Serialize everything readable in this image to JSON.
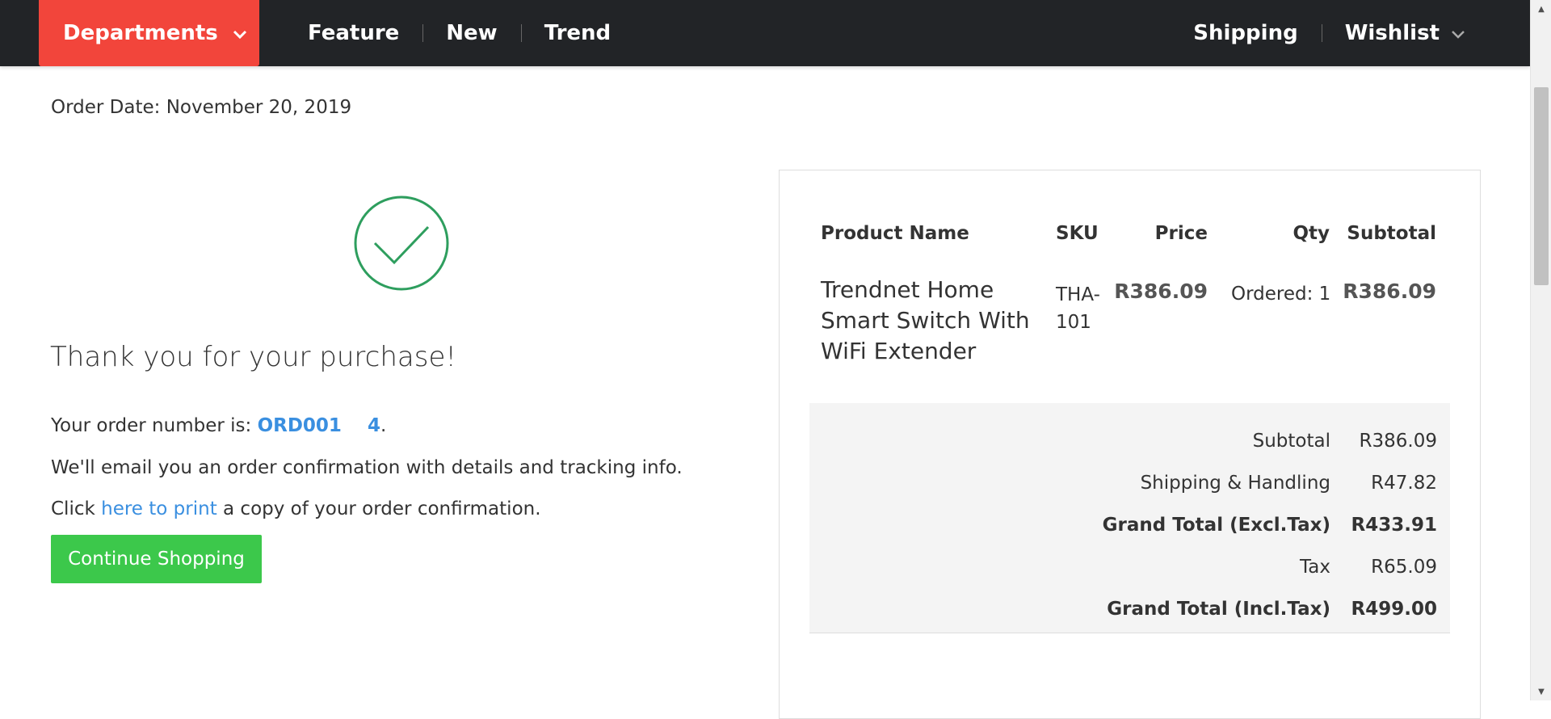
{
  "nav": {
    "departments_label": "Departments",
    "left_items": [
      "Feature",
      "New",
      "Trend"
    ],
    "right_items": [
      "Shipping",
      "Wishlist"
    ]
  },
  "order": {
    "date_text": "Order Date: November 20, 2019",
    "thank_you": "Thank you for your purchase!",
    "order_number_prefix": "Your order number is: ",
    "order_number": "ORD001    4",
    "order_number_suffix": ".",
    "email_text": "We'll email you an order confirmation with details and tracking info.",
    "print_prefix": "Click ",
    "print_link": "here to print",
    "print_suffix": " a copy of your order confirmation.",
    "continue_label": "Continue Shopping"
  },
  "table": {
    "headers": {
      "product": "Product Name",
      "sku": "SKU",
      "price": "Price",
      "qty": "Qty",
      "subtotal": "Subtotal"
    },
    "row": {
      "product": "Trendnet Home Smart Switch With WiFi Extender",
      "sku": "THA-101",
      "price": "R386.09",
      "qty": "Ordered: 1",
      "subtotal": "R386.09"
    }
  },
  "totals": [
    {
      "label": "Subtotal",
      "value": "R386.09"
    },
    {
      "label": "Shipping & Handling",
      "value": "R47.82"
    },
    {
      "label": "Grand Total (Excl.Tax)",
      "value": "R433.91"
    },
    {
      "label": "Tax",
      "value": "R65.09"
    },
    {
      "label": "Grand Total (Incl.Tax)",
      "value": "R499.00"
    }
  ],
  "colors": {
    "nav_bg": "#222427",
    "departments_bg": "#f2453b",
    "link": "#3a8fe0",
    "success_green": "#2e9e5e",
    "button_green": "#3cc84b"
  },
  "icons": {
    "departments": "chevron-down-icon",
    "wishlist": "chevron-down-icon",
    "success": "check-circle-icon"
  }
}
